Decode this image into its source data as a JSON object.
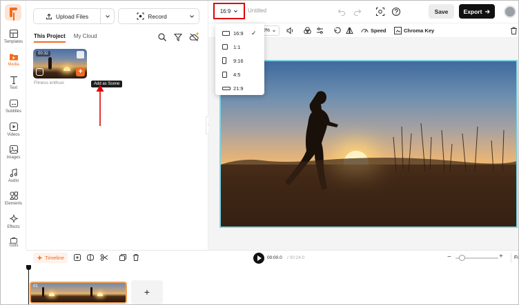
{
  "sidebar": {
    "items": [
      {
        "label": "Templates"
      },
      {
        "label": "Media"
      },
      {
        "label": "Text"
      },
      {
        "label": "Subtitles"
      },
      {
        "label": "Videos"
      },
      {
        "label": "Images"
      },
      {
        "label": "Audio"
      },
      {
        "label": "Elements"
      },
      {
        "label": "Effects"
      },
      {
        "label": "Tools"
      }
    ],
    "active": "Media"
  },
  "media_panel": {
    "upload_label": "Upload Files",
    "record_label": "Record",
    "tabs": [
      {
        "label": "This Project",
        "active": true
      },
      {
        "label": "My Cloud",
        "active": false
      }
    ],
    "clip": {
      "duration": "00:32",
      "caption": "Fitness enthusi",
      "tooltip": "Add as Scene"
    }
  },
  "topbar": {
    "ratio": "16:9",
    "title": "Untitled",
    "save_label": "Save",
    "export_label": "Export"
  },
  "toolbar": {
    "zoom": "0%",
    "speed_label": "Speed",
    "chroma_label": "Chroma Key"
  },
  "ratio_menu": {
    "items": [
      {
        "label": "16:9",
        "selected": true
      },
      {
        "label": "1:1",
        "selected": false
      },
      {
        "label": "9:16",
        "selected": false
      },
      {
        "label": "4:5",
        "selected": false
      },
      {
        "label": "21:9",
        "selected": false
      }
    ],
    "check": "✓"
  },
  "timeline": {
    "tab_label": "Timeline",
    "current_time": "00:00.0",
    "total_time": "/ 00:24.0",
    "fit_label": "Fi",
    "clip_number": "01",
    "add_symbol": "+",
    "zoom_minus": "−",
    "zoom_plus": "+"
  },
  "colors": {
    "accent": "#f26b1d",
    "highlight_box": "#e00000",
    "selection_border": "#7fd3e5",
    "annotation_arrow": "#e00000"
  }
}
